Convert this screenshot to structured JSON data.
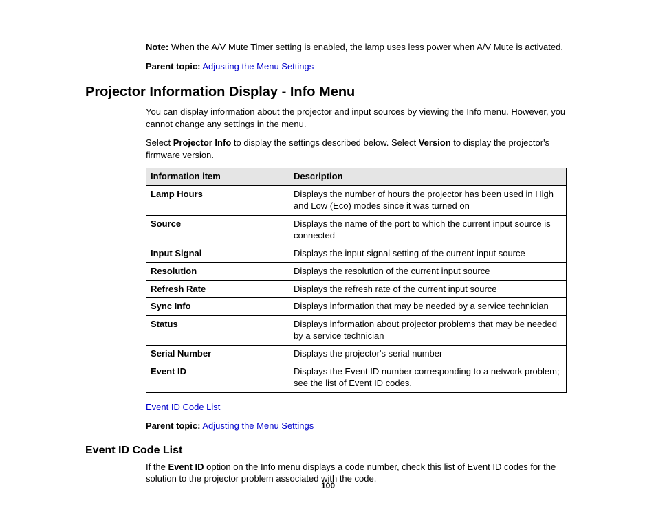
{
  "note": {
    "label": "Note:",
    "text": "When the A/V Mute Timer setting is enabled, the lamp uses less power when A/V Mute is activated."
  },
  "parent_topic_label": "Parent topic:",
  "parent_topic_link": "Adjusting the Menu Settings",
  "section_heading": "Projector Information Display - Info Menu",
  "intro1": "You can display information about the projector and input sources by viewing the Info menu. However, you cannot change any settings in the menu.",
  "intro2_pre": "Select ",
  "intro2_b1": "Projector Info",
  "intro2_mid": " to display the settings described below. Select ",
  "intro2_b2": "Version",
  "intro2_post": " to display the projector's firmware version.",
  "table": {
    "header": {
      "col1": "Information item",
      "col2": "Description"
    },
    "rows": [
      {
        "item": "Lamp Hours",
        "desc": "Displays the number of hours the projector has been used in High and Low (Eco) modes since it was turned on"
      },
      {
        "item": "Source",
        "desc": "Displays the name of the port to which the current input source is connected"
      },
      {
        "item": "Input Signal",
        "desc": "Displays the input signal setting of the current input source"
      },
      {
        "item": "Resolution",
        "desc": "Displays the resolution of the current input source"
      },
      {
        "item": "Refresh Rate",
        "desc": "Displays the refresh rate of the current input source"
      },
      {
        "item": "Sync Info",
        "desc": "Displays information that may be needed by a service technician"
      },
      {
        "item": "Status",
        "desc": "Displays information about projector problems that may be needed by a service technician"
      },
      {
        "item": "Serial Number",
        "desc": "Displays the projector's serial number"
      },
      {
        "item": "Event ID",
        "desc": "Displays the Event ID number corresponding to a network problem; see the list of Event ID codes."
      }
    ]
  },
  "link_event_id": "Event ID Code List",
  "subsection_heading": "Event ID Code List",
  "sub_para_pre": "If the ",
  "sub_para_b": "Event ID",
  "sub_para_post": " option on the Info menu displays a code number, check this list of Event ID codes for the solution to the projector problem associated with the code.",
  "page_number": "100"
}
